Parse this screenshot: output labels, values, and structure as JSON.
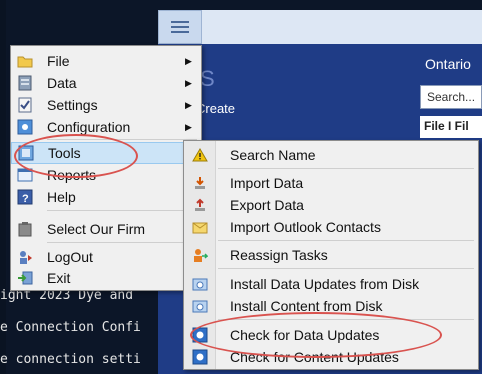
{
  "app": {
    "title_fragment": "Ontario",
    "create_label": "Create",
    "s_glyph": "S",
    "search_placeholder": "Search...",
    "col_headers": "File I  Fil"
  },
  "console": {
    "lines": [
      "ight 2023 Dye and",
      "e Connection Confi",
      "e connection setti"
    ]
  },
  "main_menu": {
    "items": [
      {
        "label": "File",
        "icon": "folder-icon",
        "has_submenu": true
      },
      {
        "label": "Data",
        "icon": "database-icon",
        "has_submenu": true
      },
      {
        "label": "Settings",
        "icon": "settings-icon",
        "has_submenu": true
      },
      {
        "label": "Configuration",
        "icon": "configuration-icon",
        "has_submenu": true
      },
      {
        "label": "Tools",
        "icon": "tools-icon",
        "has_submenu": true,
        "highlighted": true
      },
      {
        "label": "Reports",
        "icon": "reports-icon",
        "has_submenu": true
      },
      {
        "label": "Help",
        "icon": "help-icon",
        "has_submenu": true
      },
      {
        "label": "Select Our Firm",
        "icon": "firm-icon",
        "has_submenu": false
      },
      {
        "label": "LogOut",
        "icon": "logout-icon",
        "has_submenu": false
      },
      {
        "label": "Exit",
        "icon": "exit-icon",
        "has_submenu": false
      }
    ]
  },
  "tools_menu": {
    "items": [
      {
        "label": "Search Name",
        "icon": "warning-icon"
      },
      {
        "label": "Import Data",
        "icon": "import-icon"
      },
      {
        "label": "Export Data",
        "icon": "export-icon"
      },
      {
        "label": "Import Outlook Contacts",
        "icon": "outlook-contacts-icon"
      },
      {
        "label": "Reassign Tasks",
        "icon": "reassign-icon"
      },
      {
        "label": "Install Data Updates from Disk",
        "icon": "disk-install-icon"
      },
      {
        "label": "Install Content from Disk",
        "icon": "disk-install-icon"
      },
      {
        "label": "Check for Data Updates",
        "icon": "update-check-icon"
      },
      {
        "label": "Check for Content Updates",
        "icon": "update-check-icon"
      }
    ]
  },
  "colors": {
    "highlight": "#cce4f7",
    "annotation": "#d9534f",
    "panel_blue": "#1f3c86"
  }
}
